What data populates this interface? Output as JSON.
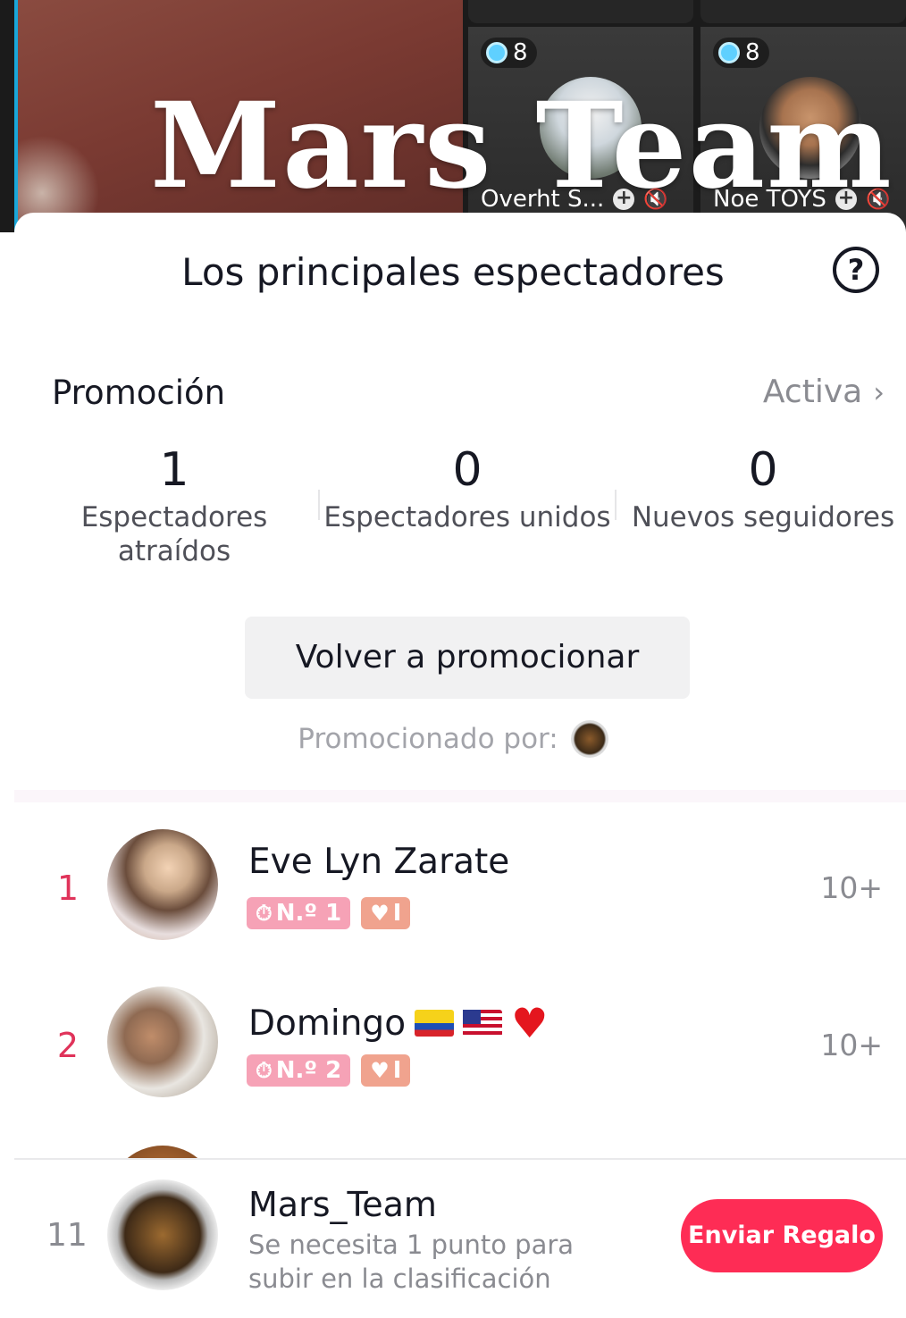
{
  "video": {
    "watermark": "Mars Team",
    "tiles": [
      {
        "count": "8",
        "name": "Overht S...",
        "icon": "user-add-icon"
      },
      {
        "count": "8",
        "name": "Noe TOYS",
        "icon": "user-add-icon"
      }
    ]
  },
  "sheet": {
    "title": "Los principales espectadores",
    "help_icon": "question-circle-icon"
  },
  "promotion": {
    "label": "Promoción",
    "status": "Activa",
    "stats": [
      {
        "value": "1",
        "label": "Espectadores atraídos"
      },
      {
        "value": "0",
        "label": "Espectadores unidos"
      },
      {
        "value": "0",
        "label": "Nuevos seguidores"
      }
    ],
    "button_label": "Volver a promocionar",
    "promoted_by": "Promocionado por:"
  },
  "ranking": [
    {
      "rank": "1",
      "name": "Eve Lyn Zarate",
      "badge_rank": "N.º 1",
      "badge_level": "I",
      "score": "10+"
    },
    {
      "rank": "2",
      "name": "Domingo",
      "badge_rank": "N.º 2",
      "badge_level": "I",
      "score": "10+"
    }
  ],
  "me": {
    "rank": "11",
    "name": "Mars_Team",
    "message": "Se necesita 1 punto para subir en la clasificación",
    "button_label": "Enviar Regalo"
  },
  "colors": {
    "accent": "#fe2c55",
    "rank_red": "#e0335a",
    "badge_pink": "#f6a2b6",
    "badge_orange": "#f0a38e"
  }
}
